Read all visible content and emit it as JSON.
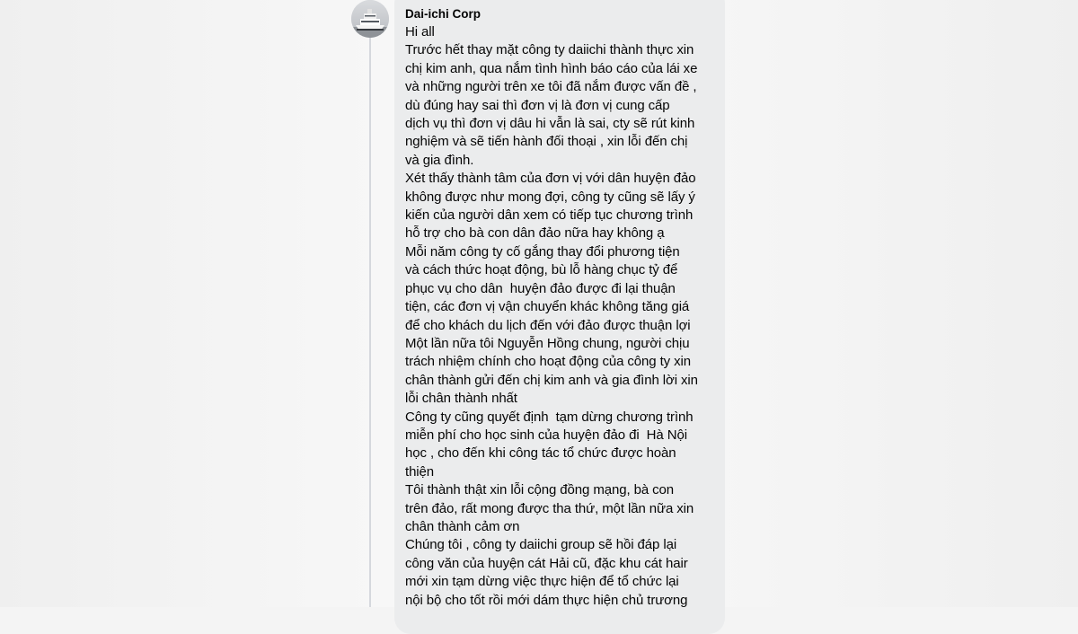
{
  "comment": {
    "author": "Dai-ichi Corp",
    "avatar_icon": "ship-photo-avatar",
    "lines": [
      "Hi all",
      "Trước hết thay mặt công ty daiichi thành thực xin",
      "chị kim anh, qua nắm tình hình báo cáo của lái xe",
      "và những người trên xe tôi đã nắm được vấn đề ,",
      "dù đúng hay sai thì đơn vị là đơn vị cung cấp",
      "dịch vụ thì đơn vị dâu hi vẫn là sai, cty sẽ rút kinh",
      "nghiệm và sẽ tiến hành đối thoại , xin lỗi đến chị",
      "và gia đình.",
      "Xét thấy thành tâm của đơn vị với dân huyện đảo",
      "không được như mong đợi, công ty cũng sẽ lấy ý",
      "kiến của người dân xem có tiếp tục chương trình",
      "hỗ trợ cho bà con dân đảo nữa hay không ạ",
      "Mỗi năm công ty cố gắng thay đổi phương tiện",
      "và cách thức hoạt động, bù lỗ hàng chục tỷ để",
      "phục vụ cho dân  huyện đảo được đi lại thuận",
      "tiện, các đơn vị vận chuyển khác không tăng giá",
      "để cho khách du lịch đến với đảo được thuận lợi",
      "Một lần nữa tôi Nguyễn Hồng chung, người chịu",
      "trách nhiệm chính cho hoạt động của công ty xin",
      "chân thành gửi đến chị kim anh và gia đình lời xin",
      "lỗi chân thành nhất",
      "Công ty cũng quyết định  tạm dừng chương trình",
      "miễn phí cho học sinh của huyện đảo đi  Hà Nội",
      "học , cho đến khi công tác tổ chức được hoàn",
      "thiện",
      "Tôi thành thật xin lỗi cộng đồng mạng, bà con",
      "trên đảo, rất mong được tha thứ, một lần nữa xin",
      "chân thành cảm ơn",
      "Chúng tôi , công ty daiichi group sẽ hồi đáp lại",
      "công văn của huyện cát Hải cũ, đặc khu cát hair",
      "mới xin tạm dừng việc thực hiện để tổ chức lại",
      "nội bộ cho tốt rồi mới dám thực hiện chủ trương"
    ]
  }
}
